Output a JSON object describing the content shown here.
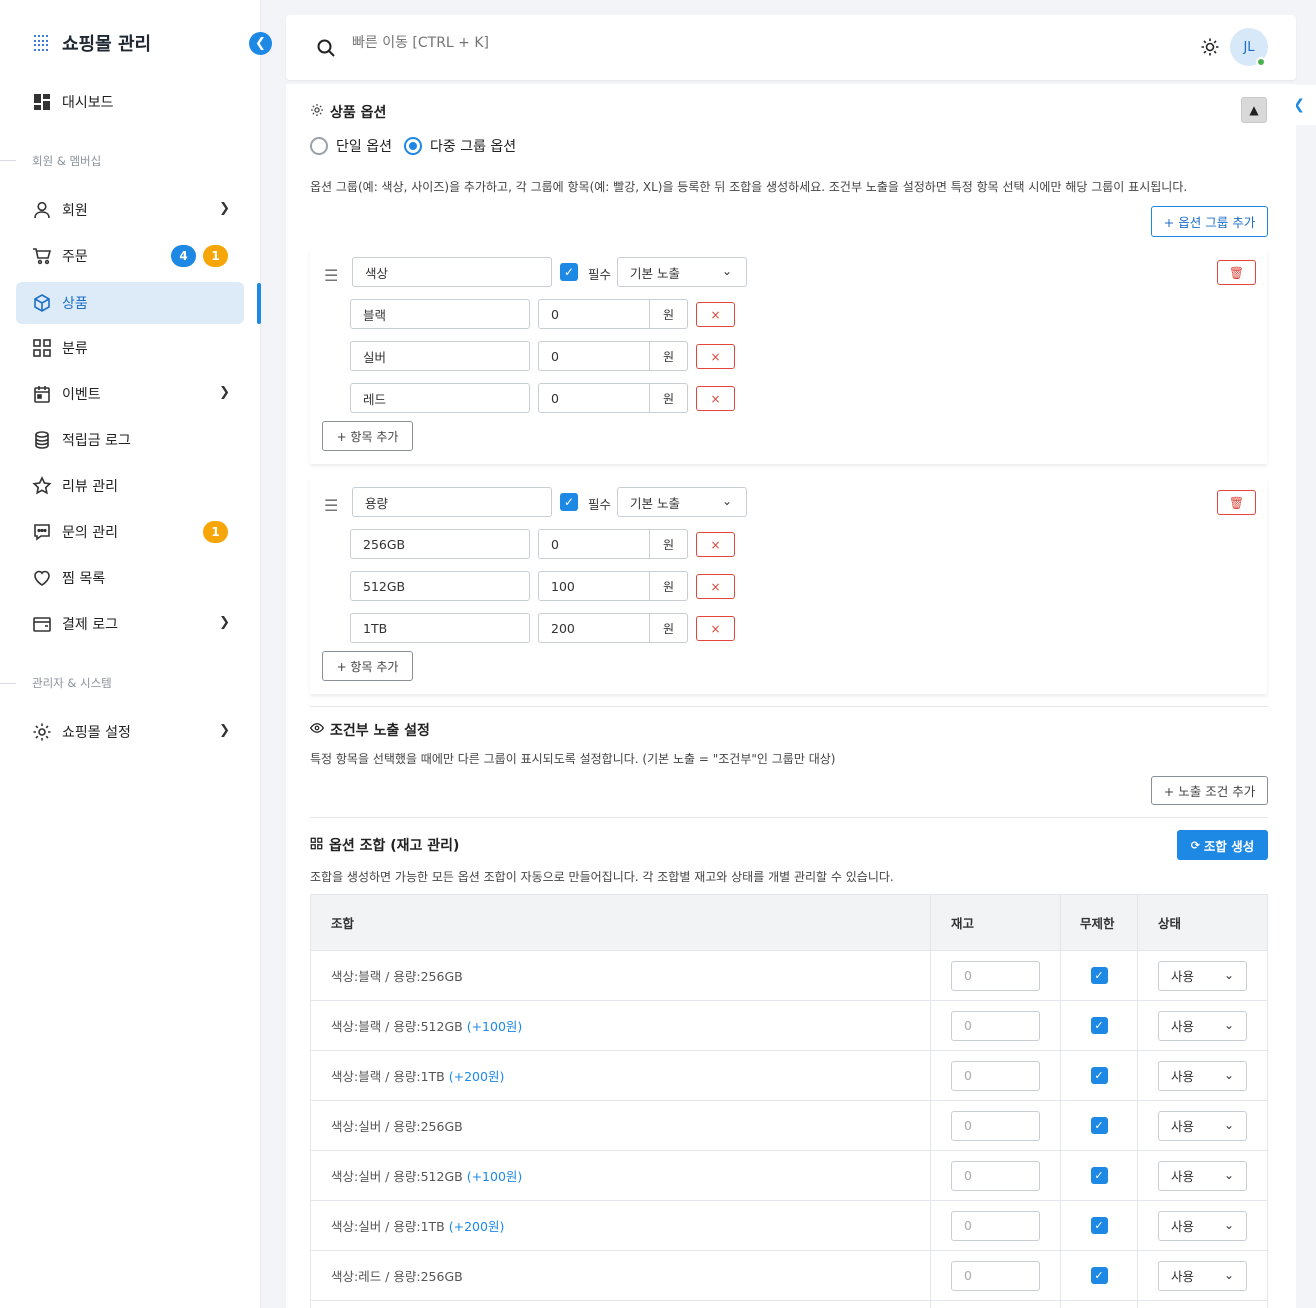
{
  "sidebar": {
    "title": "쇼핑몰 관리",
    "items": [
      {
        "label": "대시보드"
      },
      {
        "label": "회원"
      },
      {
        "label": "주문",
        "badge1": "4",
        "badge2": "1"
      },
      {
        "label": "상품"
      },
      {
        "label": "분류"
      },
      {
        "label": "이벤트"
      },
      {
        "label": "적립금 로그"
      },
      {
        "label": "리뷰 관리"
      },
      {
        "label": "문의 관리",
        "badge1": "1"
      },
      {
        "label": "찜 목록"
      },
      {
        "label": "결제 로그"
      },
      {
        "label": "쇼핑몰 설정"
      }
    ],
    "section_members": "회원 & 멤버십",
    "section_admin": "관리자 & 시스템"
  },
  "topbar": {
    "search_placeholder": "빠른 이동 [CTRL + K]",
    "avatar": "JL"
  },
  "options": {
    "title": "상품 옵션",
    "radio_single": "단일 옵션",
    "radio_multi": "다중 그룹 옵션",
    "description": "옵션 그룹(예: 색상, 사이즈)을 추가하고, 각 그룹에 항목(예: 빨강, XL)을 등록한 뒤 조합을 생성하세요. 조건부 노출을 설정하면 특정 항목 선택 시에만 해당 그룹이 표시됩니다.",
    "add_group": "+ 옵션 그룹 추가",
    "required_label": "필수",
    "currency": "원",
    "add_item": "+ 항목 추가",
    "groups": [
      {
        "name": "색상",
        "visibility": "기본 노출",
        "items": [
          {
            "name": "블랙",
            "price": "0"
          },
          {
            "name": "실버",
            "price": "0"
          },
          {
            "name": "레드",
            "price": "0"
          }
        ]
      },
      {
        "name": "용량",
        "visibility": "기본 노출",
        "items": [
          {
            "name": "256GB",
            "price": "0"
          },
          {
            "name": "512GB",
            "price": "100"
          },
          {
            "name": "1TB",
            "price": "200"
          }
        ]
      }
    ]
  },
  "conditional": {
    "title": "조건부 노출 설정",
    "description": "특정 항목을 선택했을 때에만 다른 그룹이 표시되도록 설정합니다. (기본 노출 = \"조건부\"인 그룹만 대상)",
    "add_condition": "+ 노출 조건 추가"
  },
  "combos": {
    "title": "옵션 조합 (재고 관리)",
    "generate": "조합 생성",
    "description": "조합을 생성하면 가능한 모든 옵션 조합이 자동으로 만들어집니다. 각 조합별 재고와 상태를 개별 관리할 수 있습니다.",
    "headers": {
      "combo": "조합",
      "stock": "재고",
      "unlimited": "무제한",
      "status": "상태"
    },
    "rows": [
      {
        "combo": "색상:블랙 / 용량:256GB",
        "extra": "",
        "stock": "0",
        "status": "사용"
      },
      {
        "combo": "색상:블랙 / 용량:512GB",
        "extra": "(+100원)",
        "stock": "0",
        "status": "사용"
      },
      {
        "combo": "색상:블랙 / 용량:1TB",
        "extra": "(+200원)",
        "stock": "0",
        "status": "사용"
      },
      {
        "combo": "색상:실버 / 용량:256GB",
        "extra": "",
        "stock": "0",
        "status": "사용"
      },
      {
        "combo": "색상:실버 / 용량:512GB",
        "extra": "(+100원)",
        "stock": "0",
        "status": "사용"
      },
      {
        "combo": "색상:실버 / 용량:1TB",
        "extra": "(+200원)",
        "stock": "0",
        "status": "사용"
      },
      {
        "combo": "색상:레드 / 용량:256GB",
        "extra": "",
        "stock": "0",
        "status": "사용"
      }
    ]
  },
  "colors": {
    "accent": "#1e88e5",
    "danger": "#e0463a",
    "badge_orange": "#f6a609",
    "online": "#4caf50"
  }
}
